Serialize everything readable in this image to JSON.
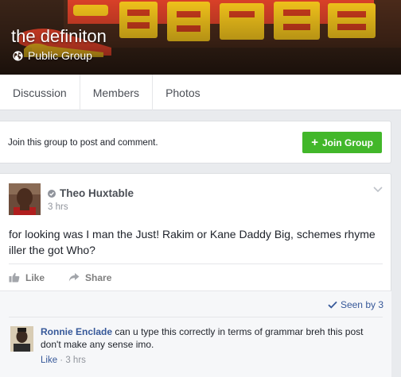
{
  "group": {
    "title": "the definiton",
    "privacy": "Public Group"
  },
  "tabs": [
    "Discussion",
    "Members",
    "Photos"
  ],
  "join": {
    "prompt": "Join this group to post and comment.",
    "button_label": "Join Group"
  },
  "post": {
    "author": "Theo Huxtable",
    "time": "3 hrs",
    "text": "for looking was I man the Just! Rakim or Kane Daddy Big, schemes rhyme iller the got Who?",
    "like_label": "Like",
    "share_label": "Share",
    "seen": "Seen by 3"
  },
  "comment": {
    "author": "Ronnie Enclade",
    "text": "can u type this correctly in terms of grammar breh this post don't make any sense imo.",
    "like_label": "Like",
    "separator": " · ",
    "time": "3 hrs"
  },
  "colors": {
    "link": "#365899",
    "join_green": "#42b72a",
    "background": "#e9ebee"
  }
}
